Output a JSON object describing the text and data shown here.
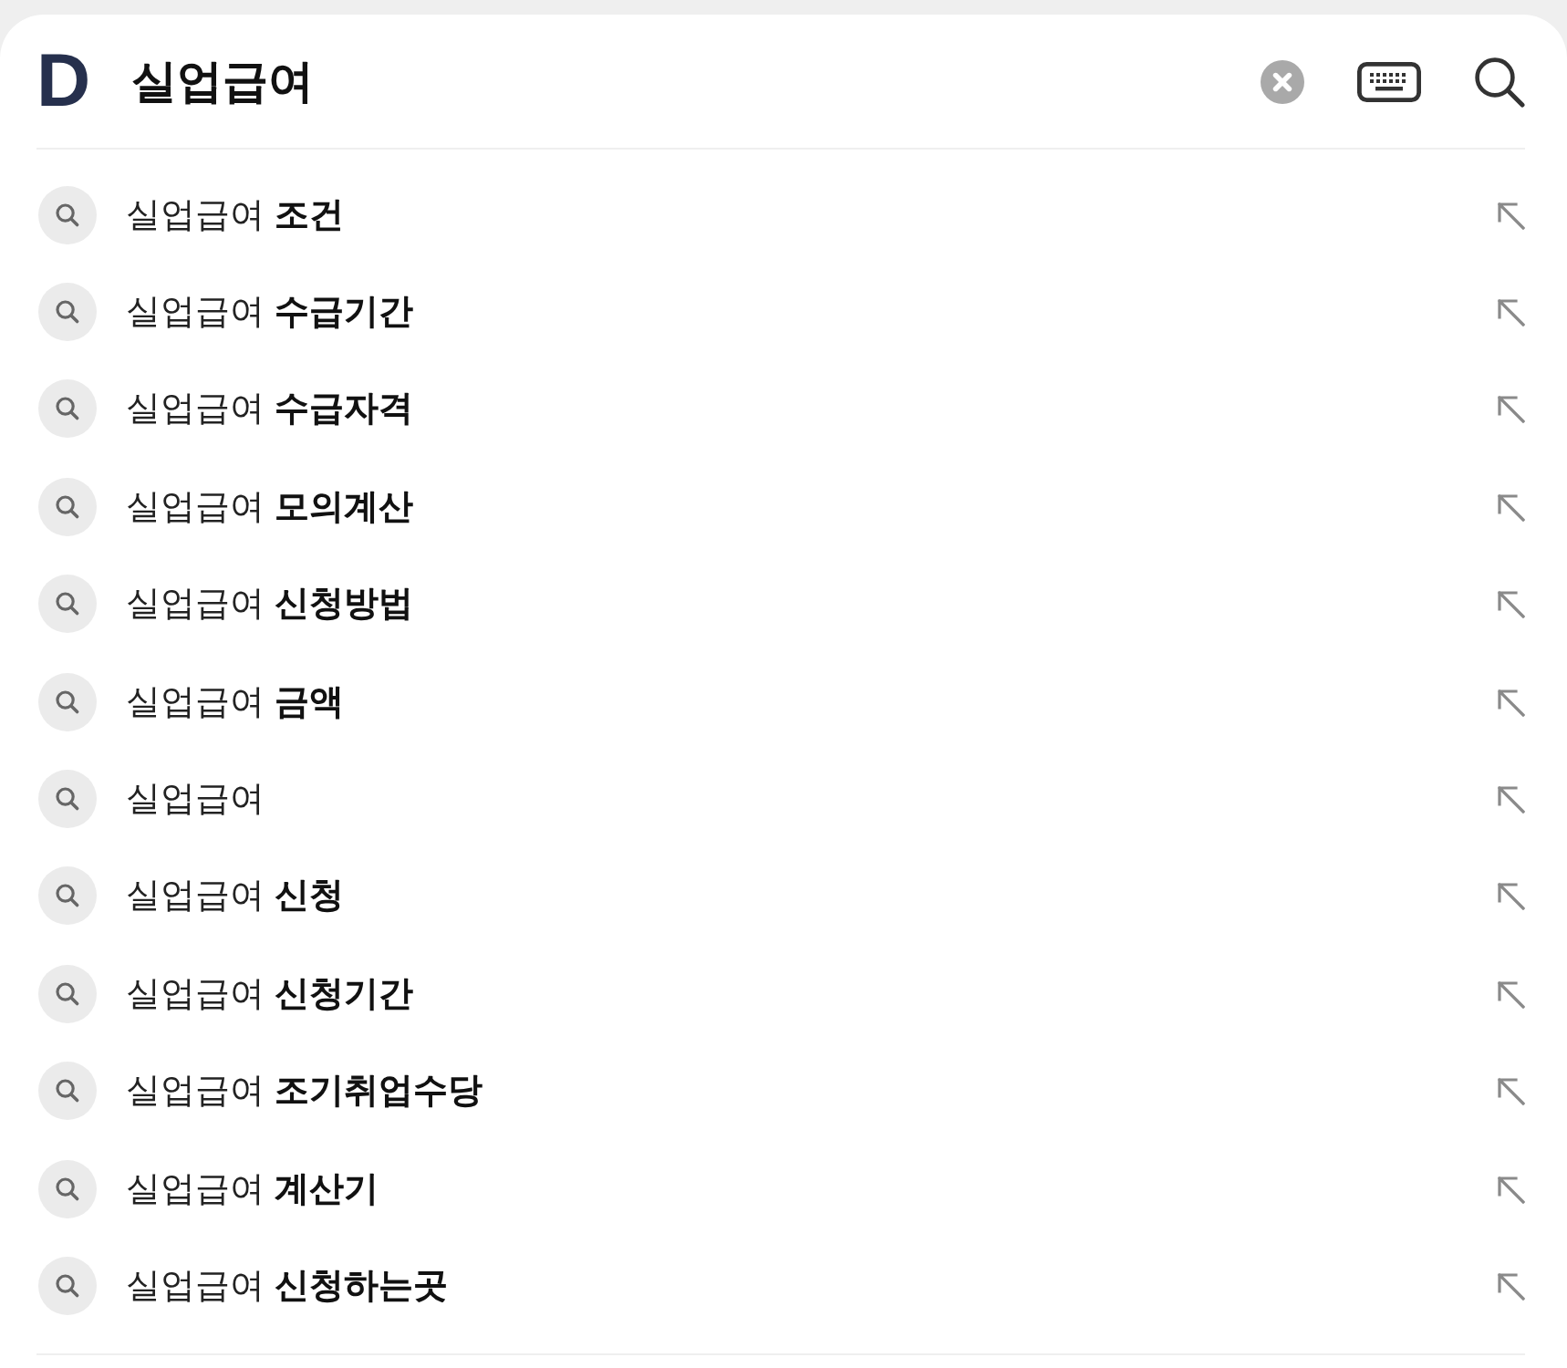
{
  "search": {
    "logo": "D",
    "value": "실업급여"
  },
  "suggestions": [
    "실업급여 **조건**",
    "실업급여 **수급기간**",
    "실업급여 **수급자격**",
    "실업급여 **모의계산**",
    "실업급여 **신청방법**",
    "실업급여 **금액**",
    "실업급여",
    "실업급여 **신청**",
    "실업급여 **신청기간**",
    "실업급여 **조기취업수당**",
    "실업급여 **계산기**",
    "실업급여 **신청하는곳**"
  ]
}
